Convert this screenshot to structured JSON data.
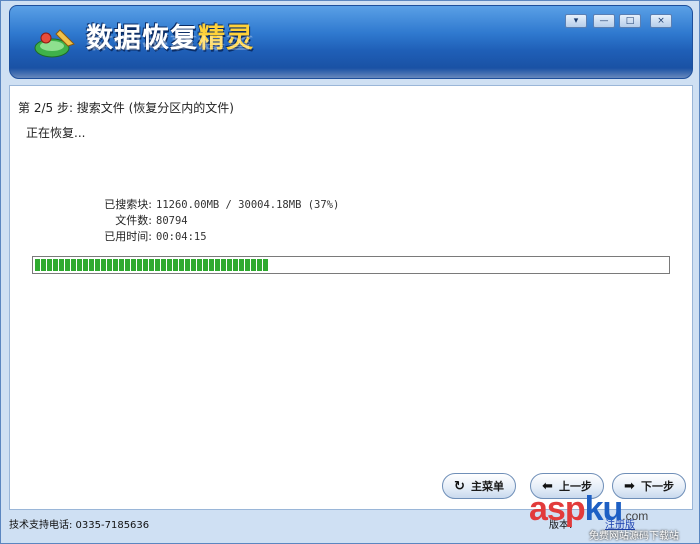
{
  "window": {
    "title_part1": "数据恢复",
    "title_part2": "精灵",
    "title_reflection": "数据恢复精灵",
    "controls": {
      "menu": "▾",
      "minimize": "—",
      "maximize": "□",
      "close": "×"
    }
  },
  "step": {
    "title": "第 2/5 步: 搜索文件 (恢复分区内的文件)",
    "status": "正在恢复..."
  },
  "info": {
    "searched_label": "已搜索块:",
    "searched_value": "11260.00MB / 30004.18MB (37%)",
    "files_label": "文件数:",
    "files_value": "80794",
    "elapsed_label": "已用时间:",
    "elapsed_value": "00:04:15"
  },
  "progress": {
    "fraction": 0.37
  },
  "buttons": {
    "main_menu": "主菜单",
    "prev": "上一步",
    "next": "下一步"
  },
  "footer": {
    "support": "技术支持电话: 0335-7185636",
    "version_label": "版本:",
    "register_link": "注册版"
  },
  "watermark": {
    "part_a": "asp",
    "part_b": "ku",
    "suffix": ".com",
    "subtitle": "免费网站源码下载站"
  },
  "colors": {
    "header_blue": "#2f79cf",
    "progress_green": "#2faa2f",
    "panel_bg": "#cfe0f3"
  }
}
